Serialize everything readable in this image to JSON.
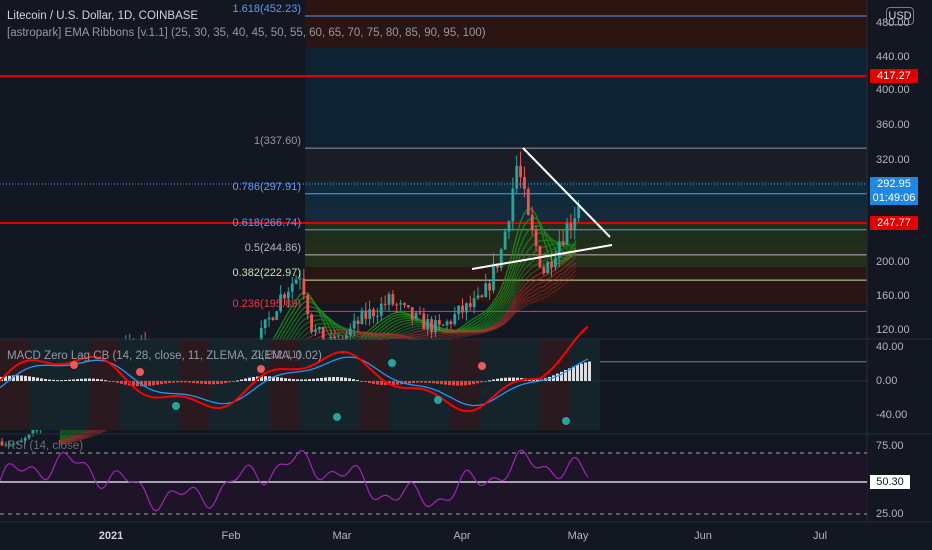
{
  "header": {
    "title": "Litecoin / U.S. Dollar, 1D, COINBASE",
    "ema_legend": "[astropark] EMA Ribbons [v.1.1] (25, 30, 35, 40, 45, 50, 55, 60, 65, 70, 75, 80, 85, 90, 95, 100)",
    "currency": "USD"
  },
  "price_axis": {
    "ticks": [
      "480.00",
      "440.00",
      "400.00",
      "360.00",
      "320.00",
      "200.00",
      "160.00",
      "120.00"
    ]
  },
  "price_labels": {
    "resistance": "417.27",
    "last_price": "292.95",
    "countdown": "01:49:06",
    "support": "247.77"
  },
  "fibonacci": {
    "levels": [
      {
        "label": "1.618(452.23)",
        "value": 452.23,
        "color": "#5b9cf6"
      },
      {
        "label": "1(337.60)",
        "value": 337.6,
        "color": "#9598a1"
      },
      {
        "label": "0.786(297.91)",
        "value": 297.91,
        "color": "#5b9cf6"
      },
      {
        "label": "0.618(266.74)",
        "value": 266.74,
        "color": "#5b9cf6"
      },
      {
        "label": "0.5(244.86)",
        "value": 244.86,
        "color": "#b2b5be"
      },
      {
        "label": "0.382(222.97)",
        "value": 222.97,
        "color": "#c9e2a6"
      },
      {
        "label": "0.236(195.89)",
        "value": 195.89,
        "color": "#f23645"
      },
      {
        "label": "0(152.11)",
        "value": 152.11,
        "color": "#787b86"
      }
    ]
  },
  "macd": {
    "legend": "MACD Zero Lag CB (14, 28, close, 11, ZLEMA, ZLEMA, 0.02)",
    "ticks": [
      "40.00",
      "0.00",
      "-40.00"
    ]
  },
  "rsi": {
    "legend": "RSI (14, close)",
    "ticks": [
      "75.00",
      "50.30",
      "25.00"
    ],
    "current": "50.30"
  },
  "time_axis": {
    "labels": [
      "2021",
      "Feb",
      "Mar",
      "Apr",
      "May",
      "Jun",
      "Jul"
    ],
    "bold_label": "2021"
  },
  "colors": {
    "up": "#26a69a",
    "down": "#ef5350",
    "level_red": "#e50000",
    "ribbon_green": "#1b8a1b",
    "ribbon_red": "#c0392b",
    "rsi_line": "#9c27b0",
    "macd_fast": "#ff0000",
    "macd_slow": "#2196f3"
  },
  "chart_data": {
    "type": "candlestick",
    "symbol": "LTCUSD",
    "interval": "1D",
    "ylim": [
      100,
      500
    ],
    "price_path": [
      {
        "date": "2020-12-01",
        "close": 85
      },
      {
        "date": "2020-12-08",
        "close": 80
      },
      {
        "date": "2020-12-15",
        "close": 98
      },
      {
        "date": "2020-12-22",
        "close": 110
      },
      {
        "date": "2020-12-29",
        "close": 125
      },
      {
        "date": "2021-01-05",
        "close": 165
      },
      {
        "date": "2021-01-10",
        "close": 170
      },
      {
        "date": "2021-01-12",
        "close": 135
      },
      {
        "date": "2021-01-18",
        "close": 150
      },
      {
        "date": "2021-01-25",
        "close": 135
      },
      {
        "date": "2021-02-01",
        "close": 135
      },
      {
        "date": "2021-02-08",
        "close": 170
      },
      {
        "date": "2021-02-14",
        "close": 210
      },
      {
        "date": "2021-02-19",
        "close": 230
      },
      {
        "date": "2021-02-22",
        "close": 180
      },
      {
        "date": "2021-02-28",
        "close": 165
      },
      {
        "date": "2021-03-07",
        "close": 190
      },
      {
        "date": "2021-03-14",
        "close": 205
      },
      {
        "date": "2021-03-20",
        "close": 190
      },
      {
        "date": "2021-03-27",
        "close": 180
      },
      {
        "date": "2021-04-01",
        "close": 195
      },
      {
        "date": "2021-04-07",
        "close": 205
      },
      {
        "date": "2021-04-12",
        "close": 250
      },
      {
        "date": "2021-04-16",
        "close": 325
      },
      {
        "date": "2021-04-19",
        "close": 270
      },
      {
        "date": "2021-04-23",
        "close": 230
      },
      {
        "date": "2021-04-27",
        "close": 260
      },
      {
        "date": "2021-04-30",
        "close": 275
      },
      {
        "date": "2021-05-02",
        "close": 292.95
      }
    ]
  }
}
